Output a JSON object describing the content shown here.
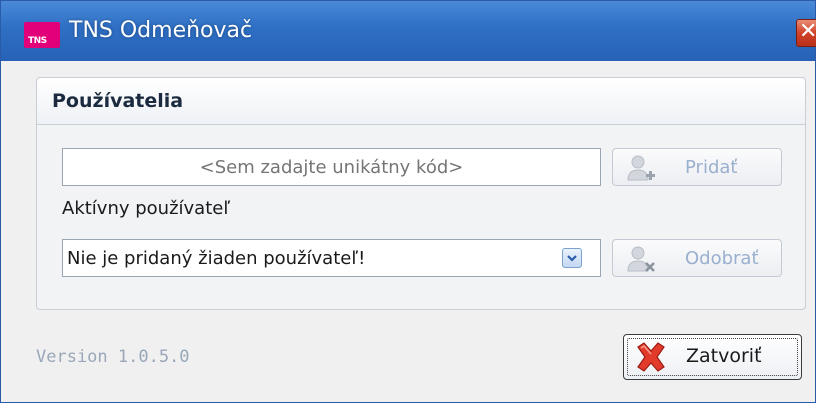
{
  "window": {
    "title": "TNS Odmeňovač",
    "logo_text": "TNS",
    "close_glyph": "✕"
  },
  "users_group": {
    "title": "Používatelia",
    "code_input": {
      "placeholder": "<Sem zadajte unikátny kód>",
      "value": ""
    },
    "add_button": {
      "label": "Pridať",
      "icon": "add-user-icon",
      "enabled": false
    },
    "active_user_label": "Aktívny používateľ",
    "user_select": {
      "selected": "Nie je pridaný žiaden používateľ!"
    },
    "remove_button": {
      "label": "Odobrať",
      "icon": "remove-user-icon",
      "enabled": false
    }
  },
  "footer": {
    "version": "Version 1.0.5.0",
    "close_button": {
      "label": "Zatvoriť",
      "icon": "red-x-icon"
    }
  },
  "colors": {
    "titlebar": "#2e6fc4",
    "logo": "#e2007a",
    "close": "#d0432a",
    "disabled_text": "#9ab0cf"
  }
}
